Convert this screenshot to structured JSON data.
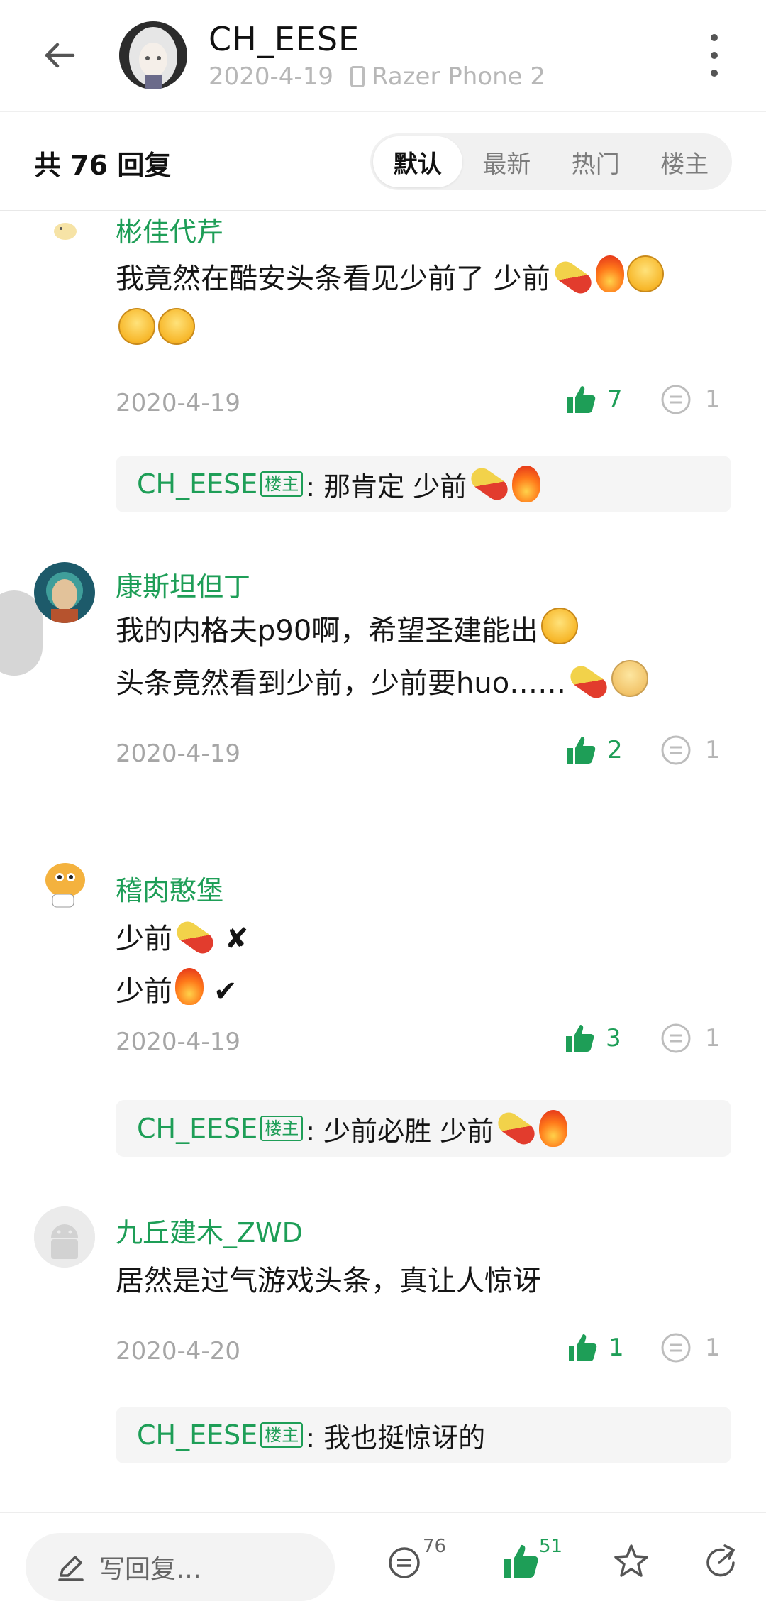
{
  "header": {
    "title": "CH_EESE",
    "date": "2020-4-19",
    "device": "Razer Phone 2"
  },
  "reply_bar": {
    "count_text": "共 76 回复",
    "tabs": [
      {
        "label": "默认",
        "active": true
      },
      {
        "label": "最新",
        "active": false
      },
      {
        "label": "热门",
        "active": false
      },
      {
        "label": "楼主",
        "active": false
      }
    ]
  },
  "comments": [
    {
      "username": "彬佳代芹",
      "lines": [
        "我竟然在酷安头条看见少前了 少前"
      ],
      "date": "2020-4-19",
      "likes": "7",
      "replies": "1",
      "sub_reply": {
        "name": "CH_EESE",
        "tag": "楼主",
        "text": ": 那肯定 少前"
      }
    },
    {
      "username": "康斯坦但丁",
      "lines": [
        "我的内格夫p90啊，希望圣建能出",
        "头条竟然看到少前，少前要huo……"
      ],
      "date": "2020-4-19",
      "likes": "2",
      "replies": "1"
    },
    {
      "username": "稽肉憨堡",
      "lines": [
        "少前",
        "少前"
      ],
      "marks": [
        "✘",
        "✔"
      ],
      "date": "2020-4-19",
      "likes": "3",
      "replies": "1",
      "sub_reply": {
        "name": "CH_EESE",
        "tag": "楼主",
        "text": ": 少前必胜 少前"
      }
    },
    {
      "username": "九丘建木_ZWD",
      "lines": [
        "居然是过气游戏头条，真让人惊讶"
      ],
      "date": "2020-4-20",
      "likes": "1",
      "replies": "1",
      "sub_reply": {
        "name": "CH_EESE",
        "tag": "楼主",
        "text": ": 我也挺惊讶的"
      }
    }
  ],
  "bottom_bar": {
    "compose_placeholder": "写回复…",
    "comment_count": "76",
    "like_count": "51"
  },
  "colors": {
    "accent": "#1e9e57",
    "muted": "#a6a6a6"
  }
}
